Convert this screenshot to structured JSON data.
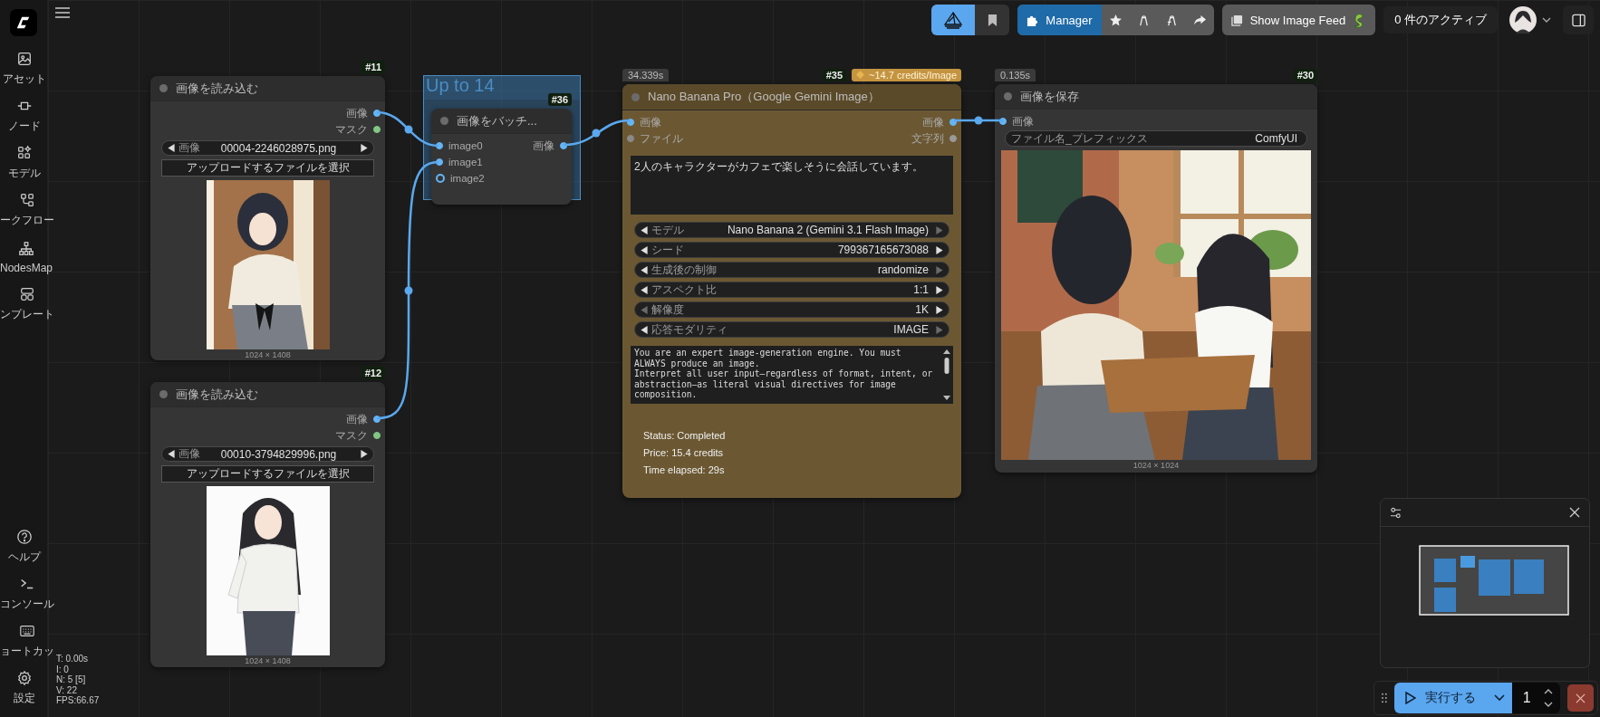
{
  "sidebar": {
    "items": [
      {
        "label": "アセット"
      },
      {
        "label": "ノード"
      },
      {
        "label": "モデル"
      },
      {
        "label": "ークフロー"
      },
      {
        "label": "NodesMap"
      },
      {
        "label": "ンプレート"
      }
    ],
    "bottom_items": [
      {
        "label": "ヘルプ"
      },
      {
        "label": "コンソール"
      },
      {
        "label": "ョートカッ"
      },
      {
        "label": "設定"
      }
    ]
  },
  "stats": [
    "T: 0.00s",
    "I: 0",
    "N: 5 [5]",
    "V: 22",
    "FPS:66.67"
  ],
  "topbar": {
    "tabs": [
      {
        "kind": "logo",
        "selected": true
      },
      {
        "kind": "bookmark",
        "selected": false
      }
    ],
    "manager": {
      "label": "Manager"
    },
    "feed_button": {
      "label": "Show Image Feed"
    },
    "queue": {
      "label": "0 件のアクティブ"
    }
  },
  "group": {
    "title": "Up to 14"
  },
  "nodes": [
    {
      "kind": "load_image",
      "badge": "#11",
      "title": "画像を読み込む",
      "outputs": [
        {
          "label": "画像",
          "color": "#64b5f6"
        },
        {
          "label": "マスク",
          "color": "#81c784"
        }
      ],
      "file_widget": {
        "label": "画像",
        "value": "00004-2246028975.png"
      },
      "upload_label": "アップロードするファイルを選択",
      "image_size": "1024 × 1408"
    },
    {
      "kind": "load_image",
      "badge": "#12",
      "title": "画像を読み込む",
      "outputs": [
        {
          "label": "画像",
          "color": "#64b5f6"
        },
        {
          "label": "マスク",
          "color": "#81c784"
        }
      ],
      "file_widget": {
        "label": "画像",
        "value": "00010-3794829996.png"
      },
      "upload_label": "アップロードするファイルを選択",
      "image_size": "1024 × 1408"
    },
    {
      "kind": "batch",
      "badge": "#36",
      "title": "画像をバッチ...",
      "inputs": [
        {
          "label": "image0",
          "color": "#64b5f6",
          "filled": true
        },
        {
          "label": "image1",
          "color": "#64b5f6",
          "filled": true
        },
        {
          "label": "image2",
          "color": "#64b5f6",
          "filled": false
        }
      ],
      "outputs": [
        {
          "label": "画像",
          "color": "#64b5f6"
        }
      ]
    },
    {
      "kind": "api",
      "badge": "#35",
      "time": "34.339s",
      "credits": "~14.7 credits/Image",
      "title": "Nano Banana Pro（Google Gemini Image）",
      "inputs": [
        {
          "label": "画像",
          "color": "#64b5f6"
        },
        {
          "label": "ファイル",
          "color": "#8a8a8a"
        }
      ],
      "outputs": [
        {
          "label": "画像",
          "color": "#64b5f6"
        },
        {
          "label": "文字列",
          "color": "#9a9a9a"
        }
      ],
      "prompt": "2人のキャラクターがカフェで楽しそうに会話しています。",
      "widgets": [
        {
          "label": "モデル",
          "value": "Nano Banana 2 (Gemini 3.1 Flash Image)",
          "prev_enabled": true,
          "next_enabled": false
        },
        {
          "label": "シード",
          "value": "799367165673088",
          "prev_enabled": true,
          "next_enabled": true
        },
        {
          "label": "生成後の制御",
          "value": "randomize",
          "prev_enabled": true,
          "next_enabled": false
        },
        {
          "label": "アスペクト比",
          "value": "1:1",
          "prev_enabled": true,
          "next_enabled": true
        },
        {
          "label": "解像度",
          "value": "1K",
          "prev_enabled": false,
          "next_enabled": true
        },
        {
          "label": "応答モダリティ",
          "value": "IMAGE",
          "prev_enabled": true,
          "next_enabled": false
        }
      ],
      "system_prompt": "You are an expert image-generation engine. You must ALWAYS produce an image.\nInterpret all user input—regardless of format, intent, or abstraction—as literal visual directives for image composition.",
      "status": [
        "Status: Completed",
        "Price: 15.4 credits",
        "Time elapsed: 29s"
      ]
    },
    {
      "kind": "save",
      "badge": "#30",
      "time": "0.135s",
      "title": "画像を保存",
      "inputs": [
        {
          "label": "画像",
          "color": "#64b5f6"
        }
      ],
      "text_widget": {
        "label": "ファイル名_プレフィックス",
        "value": "ComfyUI"
      },
      "image_size": "1024 × 1024"
    }
  ],
  "run": {
    "label": "実行する",
    "count": "1"
  }
}
